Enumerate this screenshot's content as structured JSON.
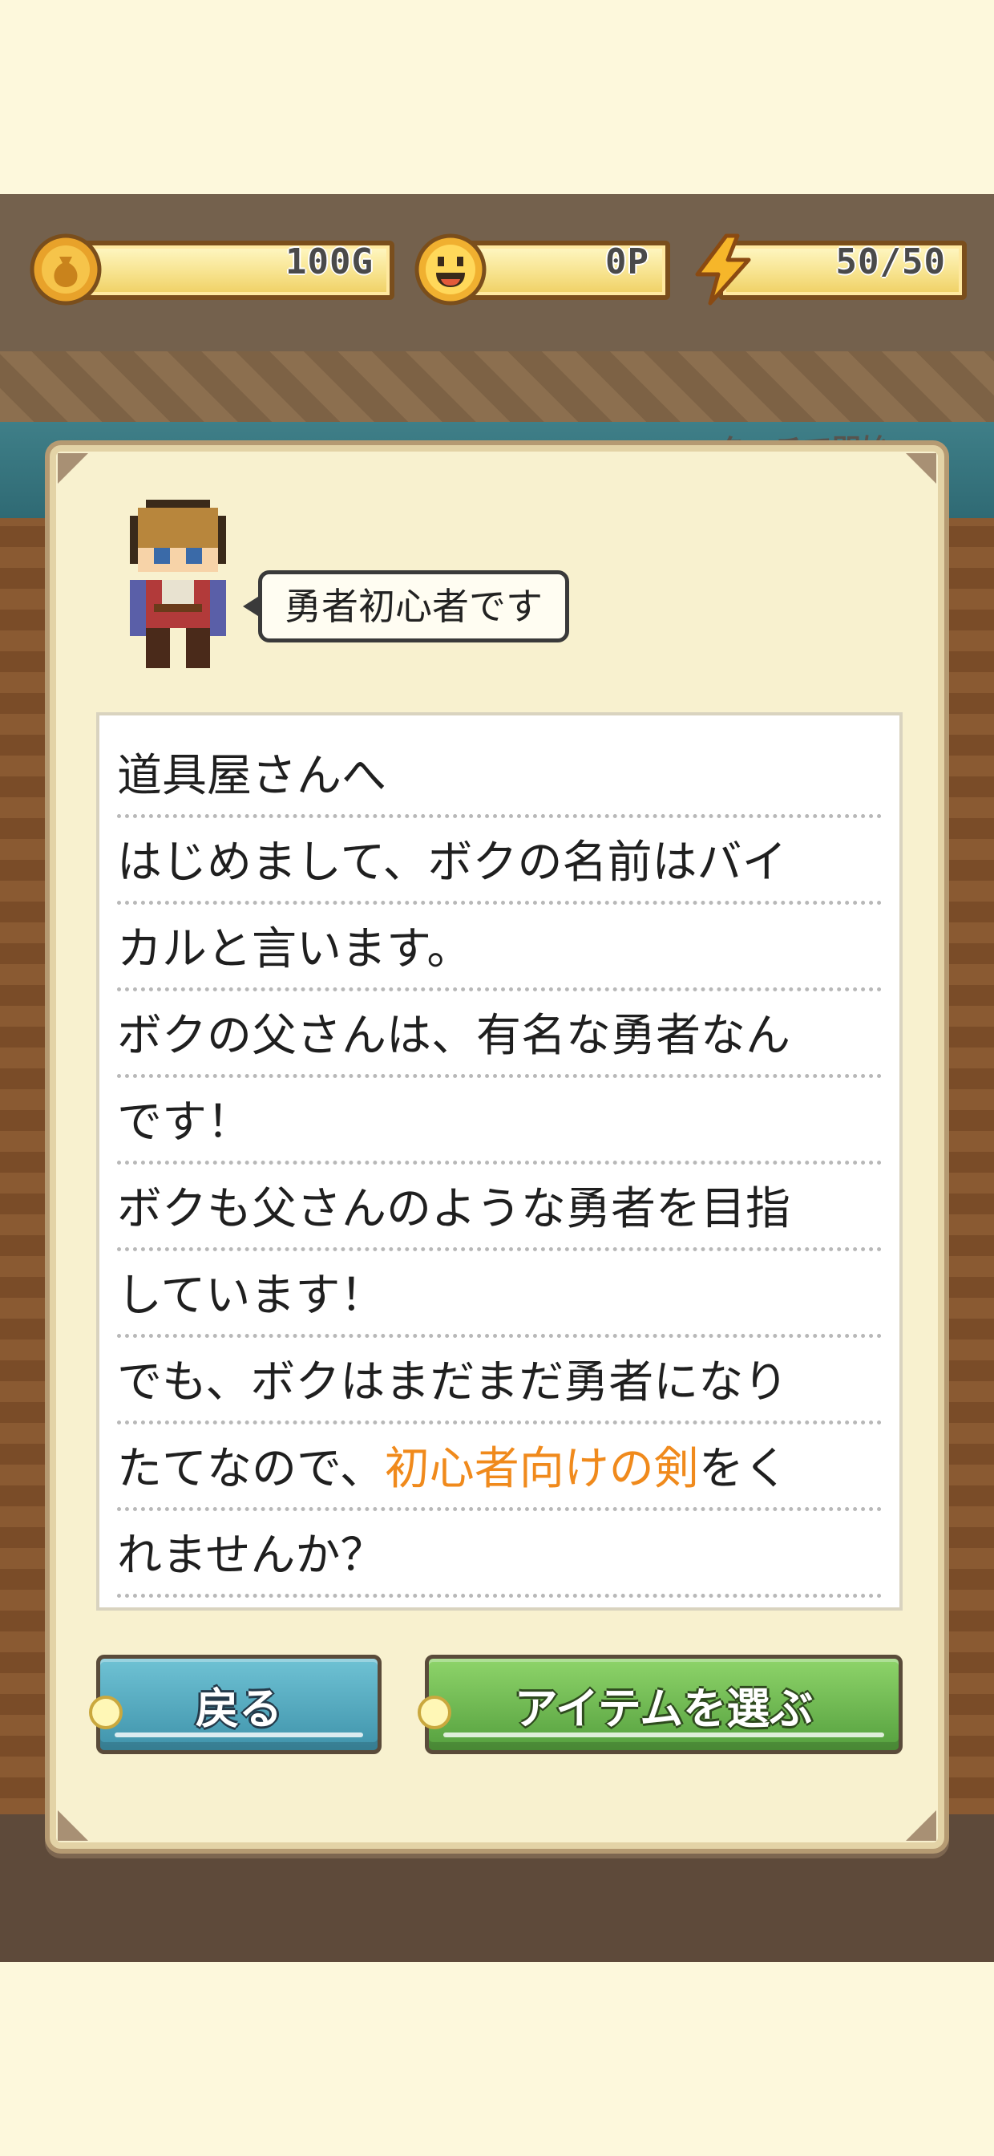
{
  "hud": {
    "gold": {
      "value": "100G",
      "icon": "gold-coin-icon"
    },
    "points": {
      "value": "0P",
      "icon": "smiley-coin-icon"
    },
    "stamina": {
      "value": "50/50",
      "icon": "lightning-icon"
    }
  },
  "scene": {
    "hint": "タッチで開始"
  },
  "dialog": {
    "customer_icon": "hero-character-sprite",
    "speech": "勇者初心者です",
    "letter": [
      {
        "text": "道具屋さんへ"
      },
      {
        "text": "はじめまして、ボクの名前はバイ"
      },
      {
        "text": "カルと言います。"
      },
      {
        "text": "ボクの父さんは、有名な勇者なん"
      },
      {
        "text": "です！"
      },
      {
        "text": "ボクも父さんのような勇者を目指"
      },
      {
        "text": "しています！"
      },
      {
        "text": "でも、ボクはまだまだ勇者になり"
      },
      {
        "pre": "たてなので、",
        "highlight": "初心者向けの剣",
        "post": "をく"
      },
      {
        "text": "れませんか？"
      }
    ],
    "buttons": {
      "back": "戻る",
      "select": "アイテムを選ぶ"
    }
  },
  "colors": {
    "highlight": "#f08a1c",
    "back_button": "#4fa8c0",
    "select_button": "#6cb84e"
  }
}
